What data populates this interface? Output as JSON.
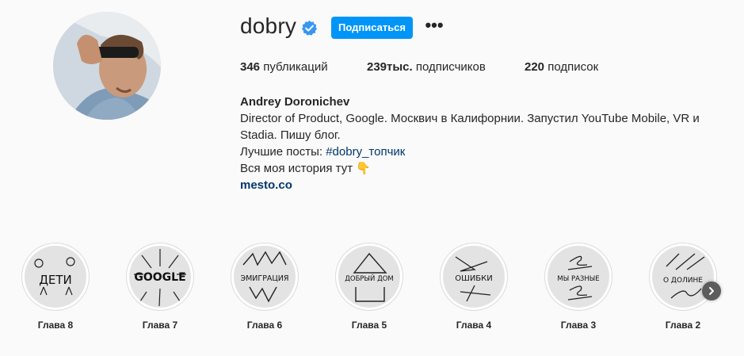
{
  "profile": {
    "username": "dobry",
    "follow_label": "Подписаться",
    "more_label": "•••",
    "stats": {
      "posts_count": "346",
      "posts_label": "публикаций",
      "followers_count": "239тыс.",
      "followers_label": "подписчиков",
      "following_count": "220",
      "following_label": "подписок"
    },
    "bio": {
      "name": "Andrey Doronichev",
      "line1": "Director of Product, Google. Москвич в Калифорнии. Запустил YouTube Mobile, VR и",
      "line2": "Stadia. Пишу блог.",
      "line3_prefix": "Лучшие посты: ",
      "hashtag": "#dobry_топчик",
      "line4": "Вся моя история тут 👇",
      "link": "mesto.co"
    }
  },
  "highlights": [
    {
      "label": "Глава 8",
      "cover_text": "ДЕТИ"
    },
    {
      "label": "Глава 7",
      "cover_text": "GOOGLE"
    },
    {
      "label": "Глава 6",
      "cover_text": "ЭМИГРАЦИЯ"
    },
    {
      "label": "Глава 5",
      "cover_text": "ДОБРЫЙ ДОМ"
    },
    {
      "label": "Глава 4",
      "cover_text": "ОШИБКИ"
    },
    {
      "label": "Глава 3",
      "cover_text": "МЫ РАЗНЫЕ"
    },
    {
      "label": "Глава 2",
      "cover_text": "О ДОЛИНЕ"
    }
  ],
  "colors": {
    "accent": "#0095f6",
    "verified": "#3897f0",
    "link": "#00376b",
    "background": "#fafafa"
  },
  "icons": {
    "verified": "verified-badge-icon",
    "next": "chevron-right-icon"
  }
}
